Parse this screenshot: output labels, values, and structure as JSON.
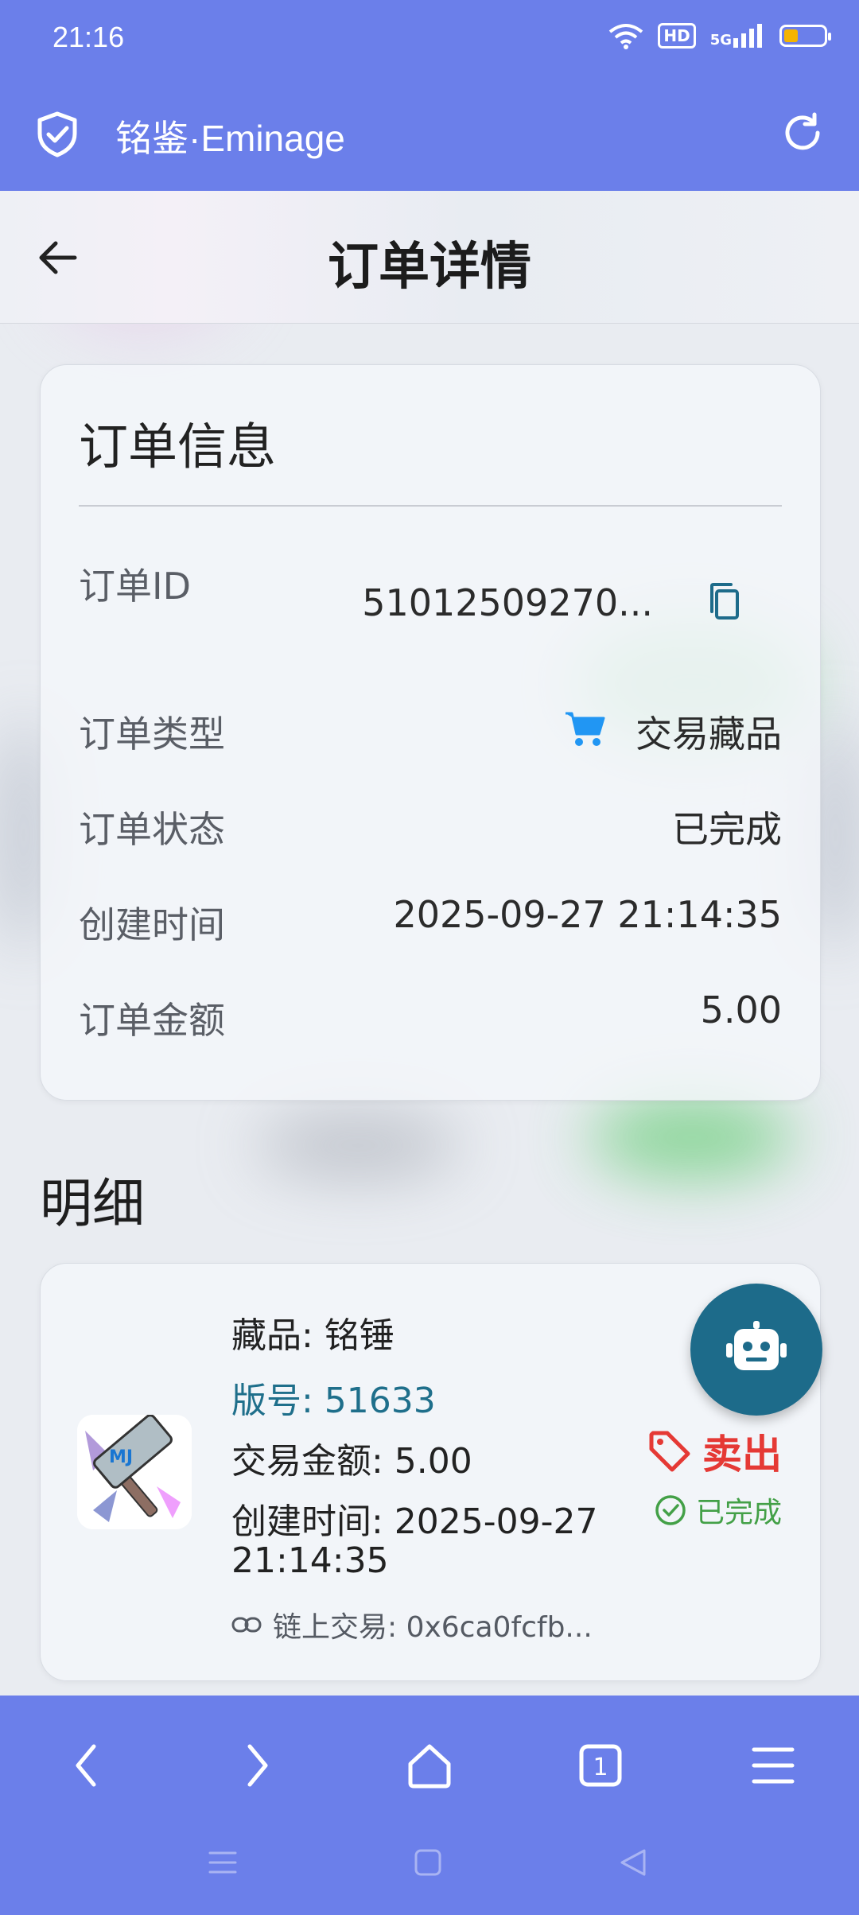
{
  "status_bar": {
    "time": "21:16",
    "hd_label": "HD",
    "network_label": "5G",
    "battery_level": 0.35
  },
  "app": {
    "title": "铭鉴·Eminage"
  },
  "page": {
    "title": "订单详情"
  },
  "order_info": {
    "title": "订单信息",
    "rows": [
      {
        "label": "订单ID",
        "value": "51012509270..."
      },
      {
        "label": "订单类型",
        "value": "交易藏品"
      },
      {
        "label": "订单状态",
        "value": "已完成"
      },
      {
        "label": "创建时间",
        "value": "2025-09-27 21:14:35"
      },
      {
        "label": "订单金额",
        "value": "5.00"
      }
    ]
  },
  "details": {
    "title": "明细",
    "item": {
      "name": "藏品: 铭锤",
      "edition": "版号: 51633",
      "amount": "交易金额: 5.00",
      "created_line1": "创建时间: 2025-09-27",
      "created_line2": "21:14:35",
      "chain_tx": "链上交易: 0x6ca0fcfb...",
      "action": "卖出",
      "status": "已完成",
      "thumb_text": "MJ"
    }
  },
  "browser_toolbar": {
    "tab_count": "1"
  },
  "colors": {
    "header": "#6b7fea",
    "accent": "#1d6b8a",
    "sell": "#e53935",
    "done": "#43a047"
  }
}
